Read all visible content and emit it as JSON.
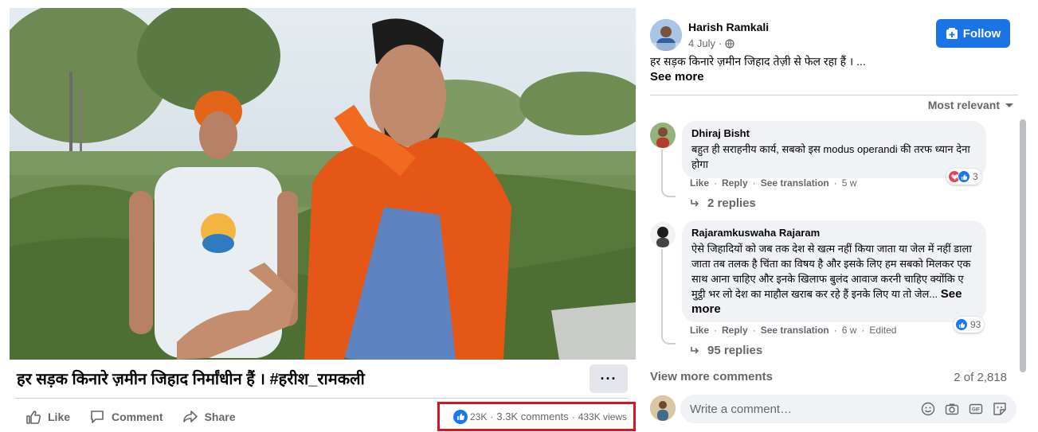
{
  "video": {
    "title": "हर सड़क किनारे ज़मीन जिहाद निर्मांधीन हैं । #हरीश_रामकली",
    "more_label": "···"
  },
  "actions": {
    "like": "Like",
    "comment": "Comment",
    "share": "Share"
  },
  "stats": {
    "reactions": "23K",
    "comments": "3.3K comments",
    "views": "433K views",
    "separator": "·",
    "highlight_color": "#e0121b"
  },
  "post": {
    "author": "Harish Ramkali",
    "date": "4 July",
    "separator": "·",
    "follow_label": "Follow",
    "text": "हर सड़क किनारे ज़मीन जिहाद तेज़ी से फेल रहा हैं । ...",
    "see_more": "See more"
  },
  "comments_sort": "Most relevant",
  "comments": [
    {
      "author": "Dhiraj Bisht",
      "text": "बहुत ही सराहनीय कार्य, सबको इस modus operandi की तरफ ध्यान देना होगा",
      "see_more": "",
      "like": "Like",
      "reply": "Reply",
      "translate": "See translation",
      "time": "5 w",
      "edited": "",
      "reaction_count": "3",
      "replies": "2 replies"
    },
    {
      "author": "Rajaramkuswaha Rajaram",
      "text": "ऐसे जिहादियों को जब तक देश से खत्म नहीं किया जाता या जेल में नहीं डाला जाता तब तलक है चिंता का विषय है और इसके लिए हम सबको मिलकर एक साथ आना चाहिए और इनके खिलाफ बुलंद आवाज करनी चाहिए क्योंकि ए मुट्ठी भर लो देश का माहौल खराब कर रहे हैं इनके लिए या तो जेल...",
      "see_more": "See more",
      "like": "Like",
      "reply": "Reply",
      "translate": "See translation",
      "time": "6 w",
      "edited": "Edited",
      "reaction_count": "93",
      "replies": "95 replies"
    }
  ],
  "view_more_comments": "View more comments",
  "comment_count": "2 of 2,818",
  "composer": {
    "placeholder": "Write a comment…"
  },
  "icons": {
    "like": "thumbs-up-icon",
    "comment": "speech-bubble-icon",
    "share": "share-arrow-icon",
    "globe": "globe-icon",
    "follow": "add-page-icon",
    "sort": "caret-down-icon",
    "replies": "reply-arrow-icon",
    "emoji": "emoji-icon",
    "camera": "camera-icon",
    "gif": "gif-icon",
    "sticker": "sticker-icon"
  },
  "colors": {
    "brand_blue": "#1b74e4",
    "secondary_text": "#65676b",
    "bubble_bg": "#f0f2f5",
    "love_red": "#f33e58"
  }
}
